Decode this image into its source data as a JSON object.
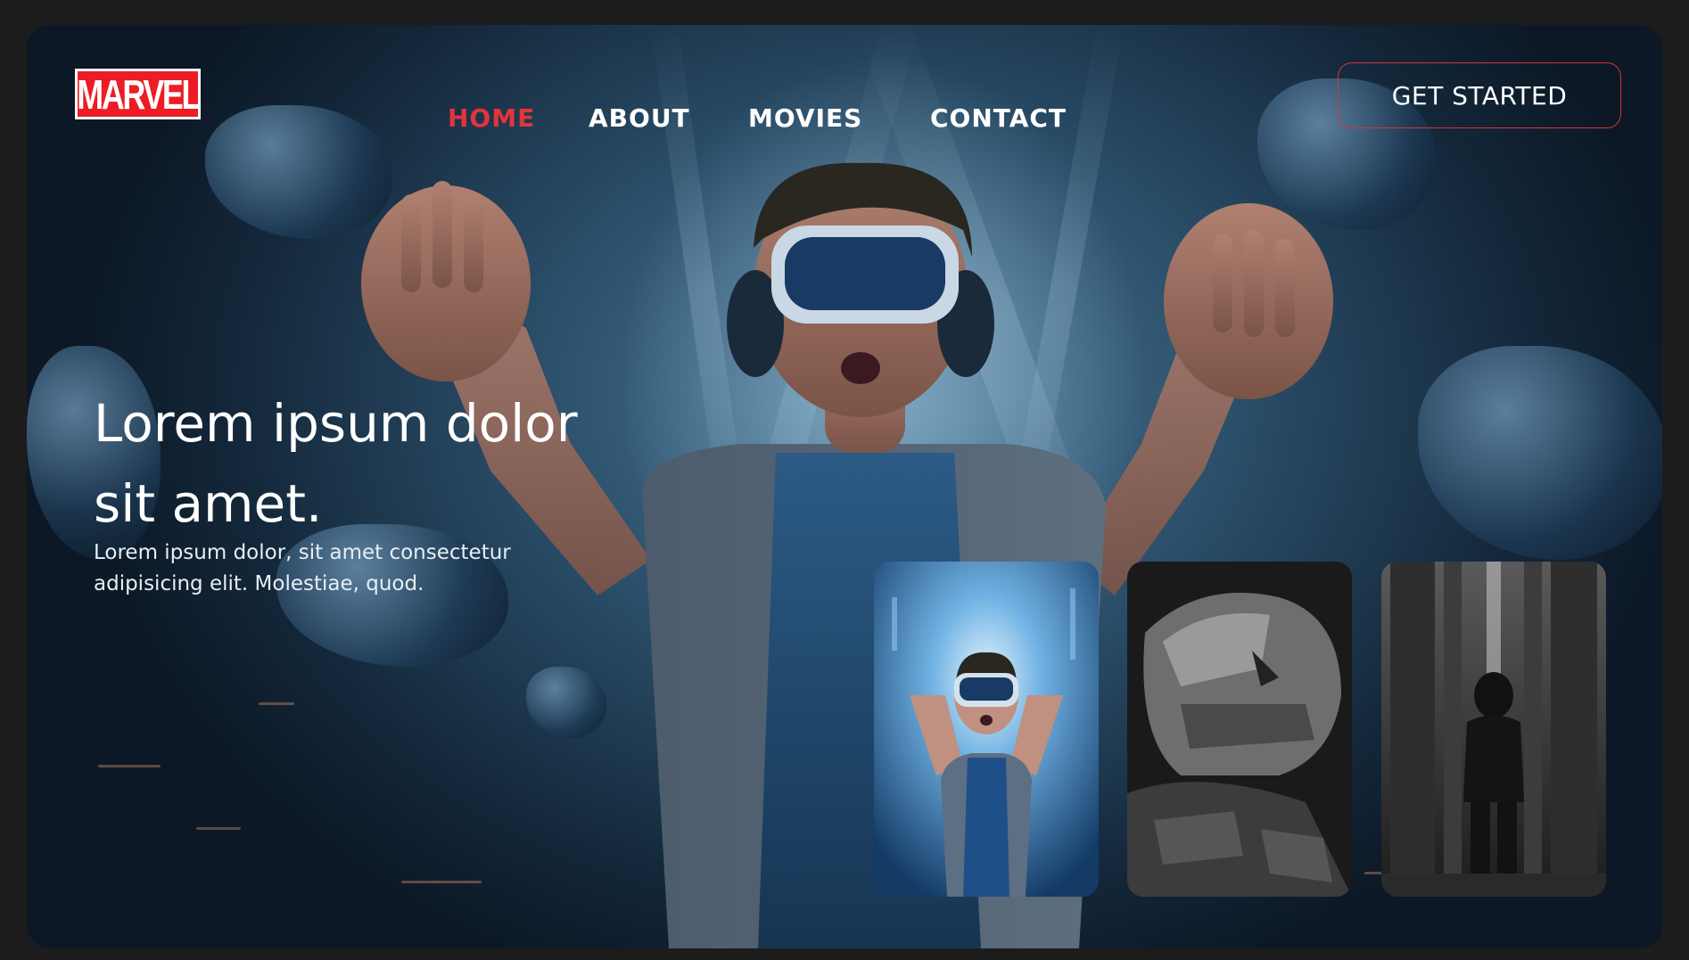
{
  "brand": {
    "logo_text": "MARVEL",
    "logo_color": "#ec1d24"
  },
  "nav": {
    "items": [
      {
        "label": "HOME",
        "active": true
      },
      {
        "label": "ABOUT",
        "active": false
      },
      {
        "label": "MOVIES",
        "active": false
      },
      {
        "label": "CONTACT",
        "active": false
      }
    ],
    "active_color": "#e1343b"
  },
  "cta": {
    "label": "GET STARTED",
    "border_color": "#d7343c"
  },
  "hero": {
    "title": "Lorem ipsum dolor sit amet.",
    "subtitle": "Lorem ipsum dolor, sit amet consectetur adipisicing elit. Molestiae, quod."
  },
  "gallery": {
    "cards": [
      {
        "subject": "vr-kid",
        "tone": "color"
      },
      {
        "subject": "robot-tiger",
        "tone": "grayscale"
      },
      {
        "subject": "masked-figure-city",
        "tone": "grayscale"
      }
    ]
  }
}
